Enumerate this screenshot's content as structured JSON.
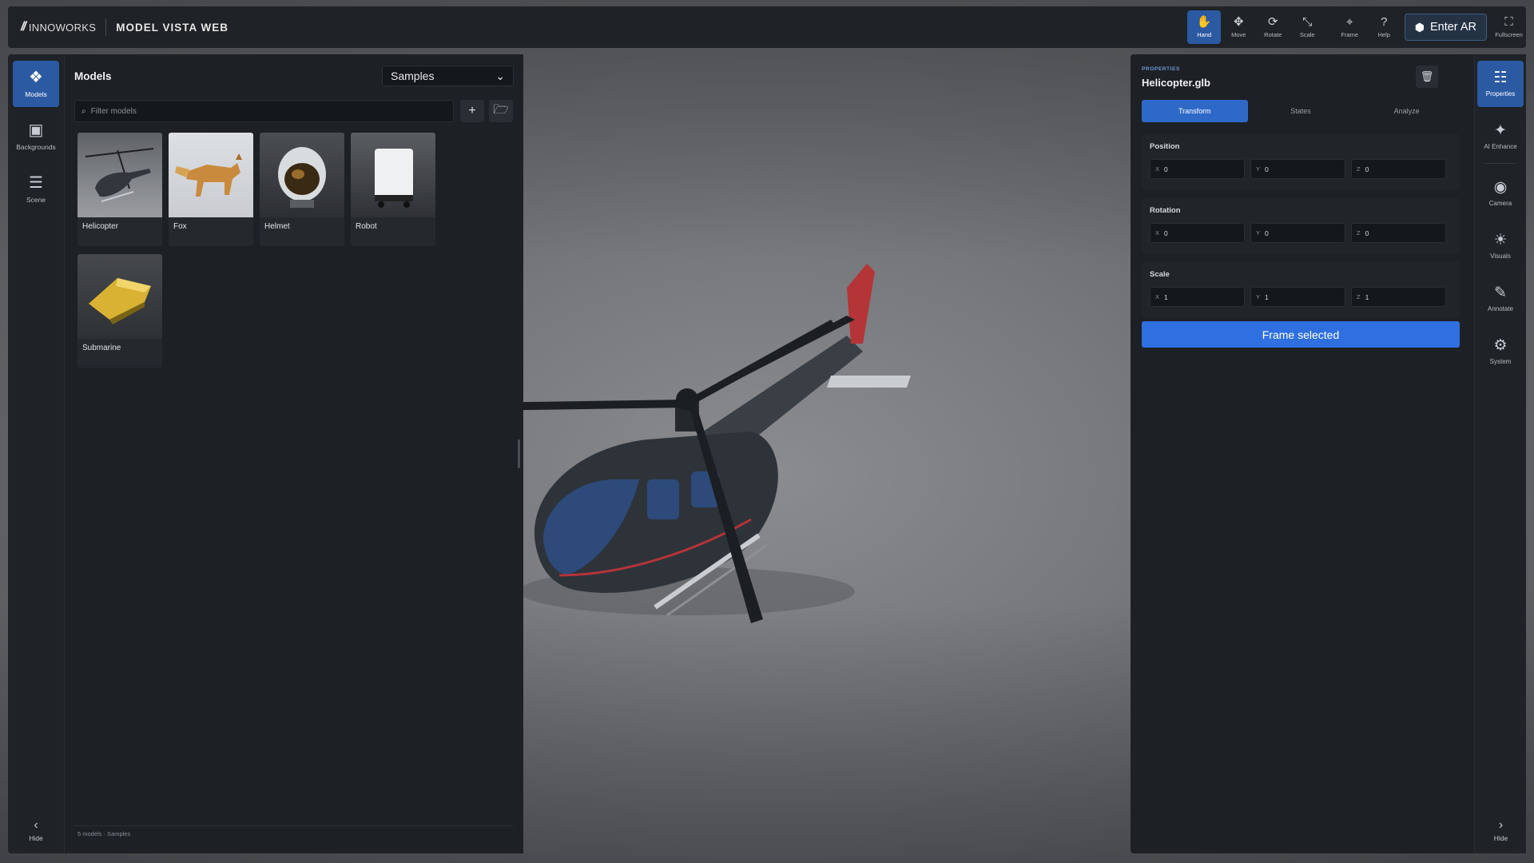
{
  "brand": {
    "logo": "//",
    "name": "INNOWORKS"
  },
  "app_title": "MODEL VISTA WEB",
  "toolbar": {
    "tools": [
      {
        "icon": "hand-icon",
        "glyph": "✋",
        "label": "Hand"
      },
      {
        "icon": "move-icon",
        "glyph": "✥",
        "label": "Move"
      },
      {
        "icon": "rotate-icon",
        "glyph": "⟳",
        "label": "Rotate"
      },
      {
        "icon": "scale-icon",
        "glyph": "⤡",
        "label": "Scale"
      },
      {
        "icon": "frame-icon",
        "glyph": "⌖",
        "label": "Frame"
      },
      {
        "icon": "help-icon",
        "glyph": "?",
        "label": "Help"
      }
    ],
    "enter_ar_label": "Enter AR",
    "fullscreen_label": "Fullscreen",
    "active_tool": "Hand"
  },
  "left_rail": {
    "items": [
      {
        "icon": "models-icon",
        "label": "Models"
      },
      {
        "icon": "backgrounds-icon",
        "label": "Backgrounds"
      },
      {
        "icon": "scene-icon",
        "label": "Scene"
      }
    ],
    "hide_label": "Hide"
  },
  "models_panel": {
    "title": "Models",
    "source_selected": "Samples",
    "search_placeholder": "Filter models",
    "models": [
      {
        "name": "Helicopter"
      },
      {
        "name": "Fox"
      },
      {
        "name": "Helmet"
      },
      {
        "name": "Robot"
      },
      {
        "name": "Submarine"
      }
    ],
    "footer": "5 models · Samples"
  },
  "properties": {
    "kicker": "PROPERTIES",
    "title": "Helicopter.glb",
    "tabs": [
      "Transform",
      "States",
      "Analyze"
    ],
    "active_tab": "Transform",
    "sections": [
      {
        "label": "Position",
        "x": "0",
        "y": "0",
        "z": "0"
      },
      {
        "label": "Rotation",
        "x": "0",
        "y": "0",
        "z": "0"
      },
      {
        "label": "Scale",
        "x": "1",
        "y": "1",
        "z": "1"
      }
    ],
    "axis_labels": {
      "x": "X",
      "y": "Y",
      "z": "Z"
    },
    "frame_button": "Frame selected"
  },
  "right_rail": {
    "items": [
      {
        "icon": "properties-icon",
        "label": "Properties"
      },
      {
        "icon": "ai-enhance-icon",
        "label": "AI Enhance"
      },
      {
        "icon": "camera-icon",
        "label": "Camera"
      },
      {
        "icon": "visuals-icon",
        "label": "Visuals"
      },
      {
        "icon": "annotate-icon",
        "label": "Annotate"
      },
      {
        "icon": "system-icon",
        "label": "System"
      }
    ],
    "hide_label": "Hide"
  },
  "colors": {
    "accent": "#2f69c8",
    "panel": "#1d2024",
    "topbar": "#1f2226",
    "viewport": "#76787c"
  }
}
